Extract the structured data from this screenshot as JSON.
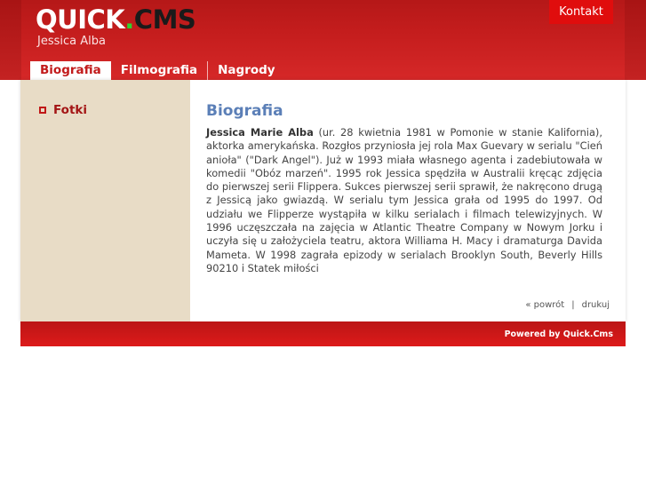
{
  "header": {
    "logo": {
      "quick": "QUICK",
      "dot": ".",
      "cms": "CMS"
    },
    "subtitle": "Jessica Alba",
    "contact_label": "Kontakt"
  },
  "nav": {
    "tabs": [
      {
        "label": "Biografia",
        "active": true
      },
      {
        "label": "Filmografia",
        "active": false
      },
      {
        "label": "Nagrody",
        "active": false
      }
    ]
  },
  "sidebar": {
    "items": [
      {
        "label": "Fotki",
        "icon": "square-bullet-icon"
      }
    ]
  },
  "main": {
    "title": "Biografia",
    "bio_name": "Jessica Marie Alba",
    "bio_text": " (ur. 28 kwietnia 1981 w Pomonie w stanie Kalifornia), aktorka amerykańska. Rozgłos przyniosła jej rola Max Guevary w serialu \"Cień anioła\" (\"Dark Angel\"). Już w 1993 miała własnego agenta i zadebiutowała w komedii \"Obóz marzeń\". 1995 rok Jessica spędziła w Australii kręcąc zdjęcia do pierwszej serii Flippera. Sukces pierwszej serii sprawił, że nakręcono drugą z Jessicą jako gwiazdą. W serialu tym Jessica grała od 1995 do 1997. Od udziału we Flipperze wystąpiła w kilku serialach i filmach telewizyjnych. W 1996 uczęszczała na zajęcia w Atlantic Theatre Company w Nowym Jorku i uczyła się u założyciela teatru, aktora Williama H. Macy i dramaturga Davida Mameta. W 1998 zagrała epizody w serialach Brooklyn South, Beverly Hills 90210 i Statek miłości",
    "back_label": "« powrót",
    "separator": "|",
    "print_label": "drukuj"
  },
  "footer": {
    "powered_by": "Powered by Quick.Cms"
  },
  "colors": {
    "header_red": "#c41d1d",
    "contact_red": "#e00d0d",
    "sidebar_beige": "#e8dcc6",
    "title_blue": "#5b7fb7",
    "logo_dot_green": "#2fd32f"
  }
}
